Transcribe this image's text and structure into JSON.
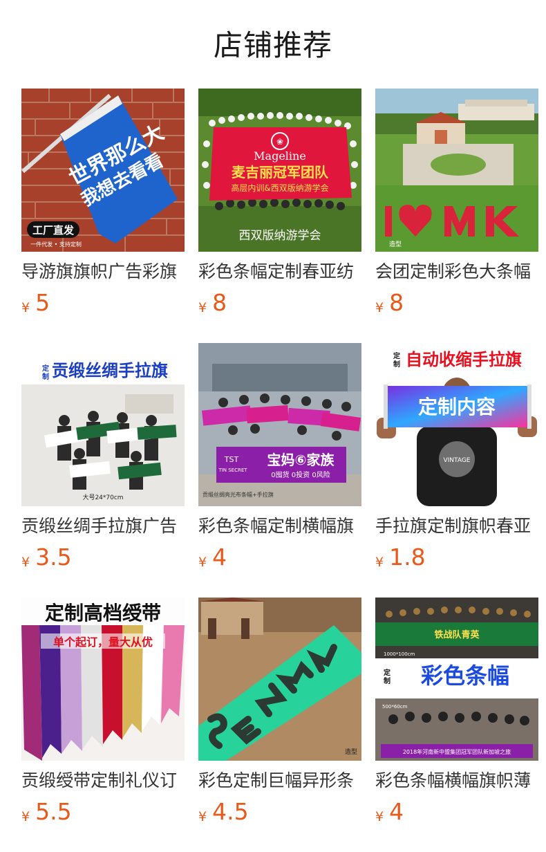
{
  "section": {
    "title": "店铺推荐"
  },
  "colors": {
    "price": "#e8591a",
    "title": "#1a1a1a",
    "name": "#333333"
  },
  "currency": "¥",
  "products": [
    {
      "name": "导游旗旗帜广告彩旗",
      "price": "5",
      "image": "blue-hand-flag-on-brick-wall",
      "image_text": {
        "flag": "世界那么大 我想去看看",
        "badge": "工厂直发",
        "sub": "一件代发 • 支持定制"
      }
    },
    {
      "name": "彩色条幅定制春亚纺",
      "price": "8",
      "image": "red-banner-crowd-on-lawn",
      "image_text": {
        "brand": "Mageline",
        "banner": "麦吉丽冠军团队",
        "sub": "高层内训&西双版纳游学会",
        "caption": "西双版纳游学会"
      }
    },
    {
      "name": "会团定制彩色大条幅",
      "price": "8",
      "image": "aerial-crowd-heart-formation",
      "image_text": {
        "formation": "I ♥ MK",
        "tag": "造型"
      }
    },
    {
      "name": "贡缎丝绸手拉旗广告",
      "price": "3.5",
      "image": "satin-hand-pull-flags-group",
      "image_text": {
        "headline": "贡缎丝绸手拉旗",
        "prefix": "定制",
        "size": "大号24*70cm"
      }
    },
    {
      "name": "彩色条幅定制横幅旗",
      "price": "4",
      "image": "purple-banner-group-photo",
      "image_text": {
        "banner": "宝妈⑥家族",
        "brand": "TST TIN SECRET",
        "sub": "0囤货 0投资 0风险",
        "caption": "贡缎丝绸亮光布条幅+手拉旗"
      }
    },
    {
      "name": "手拉旗定制旗帜春亚",
      "price": "1.8",
      "image": "auto-retract-hand-flag-man",
      "image_text": {
        "headline": "自动收缩手拉旗",
        "prefix": "定制",
        "flag": "定制内容",
        "shirt": "VINTAGE"
      }
    },
    {
      "name": "贡缎绶带定制礼仪订",
      "price": "5.5",
      "image": "ceremonial-sashes-fan",
      "image_text": {
        "headline": "定制高档绶带",
        "sub": "单个起订，量大从优"
      }
    },
    {
      "name": "彩色定制巨幅异形条",
      "price": "4.5",
      "image": "giant-green-letter-banner",
      "image_text": {
        "letters": "SENMY",
        "tag": "造型"
      }
    },
    {
      "name": "彩色条幅横幅旗帜薄",
      "price": "4",
      "image": "color-banner-event-collage",
      "image_text": {
        "headline": "彩色条幅",
        "prefix": "定制",
        "size1": "1000*100cm",
        "size2": "500*60cm",
        "banner": "2018年河南新中盟集团冠军团队新加坡之旅"
      }
    }
  ]
}
